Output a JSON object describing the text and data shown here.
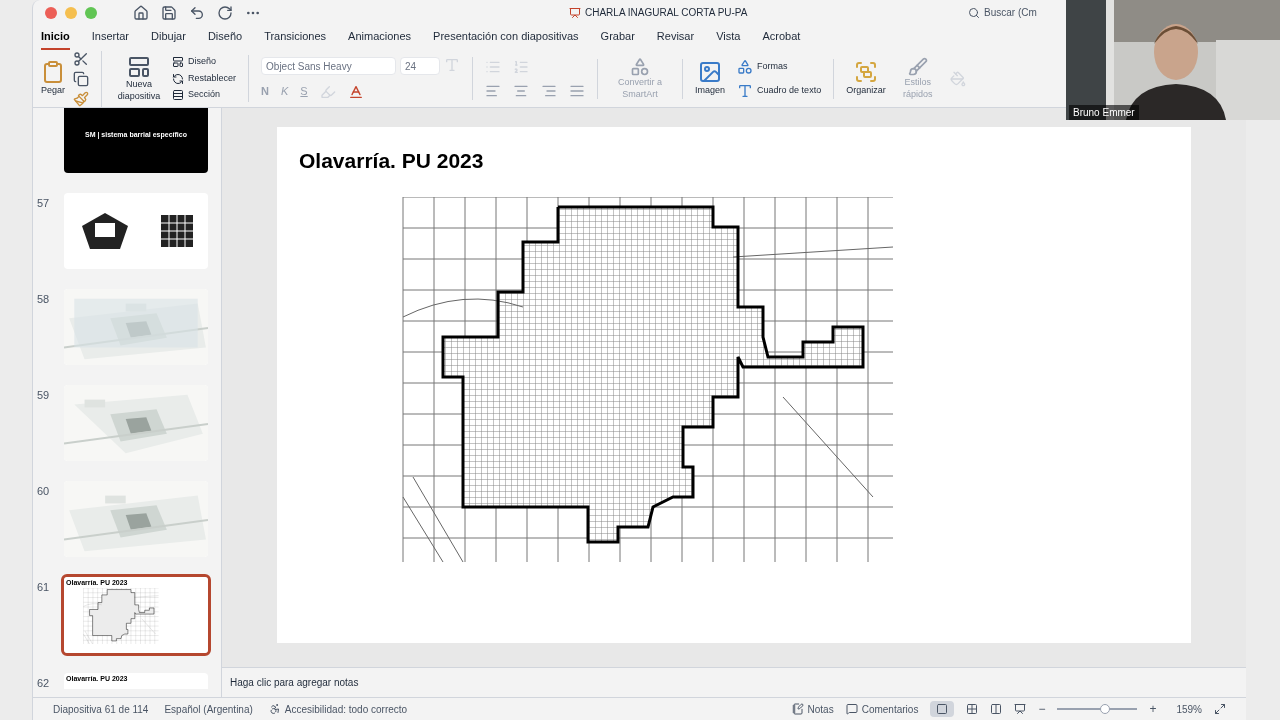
{
  "window": {
    "title": "CHARLA INAGURAL CORTA PU-PA",
    "search_placeholder": "Buscar (Cm"
  },
  "menu_tabs": [
    {
      "label": "Inicio",
      "selected": true
    },
    {
      "label": "Insertar",
      "selected": false
    },
    {
      "label": "Dibujar",
      "selected": false
    },
    {
      "label": "Diseño",
      "selected": false
    },
    {
      "label": "Transiciones",
      "selected": false
    },
    {
      "label": "Animaciones",
      "selected": false
    },
    {
      "label": "Presentación con diapositivas",
      "selected": false
    },
    {
      "label": "Grabar",
      "selected": false
    },
    {
      "label": "Revisar",
      "selected": false
    },
    {
      "label": "Vista",
      "selected": false
    },
    {
      "label": "Acrobat",
      "selected": false
    }
  ],
  "ribbon": {
    "paste": "Pegar",
    "new_slide": "Nueva diapositiva",
    "layout": "Diseño",
    "reset": "Restablecer",
    "section": "Sección",
    "font_name": "Object Sans Heavy",
    "font_size": "24",
    "format_letters": [
      "N",
      "K",
      "S"
    ],
    "smartart": "Convertir a SmartArt",
    "image": "Imagen",
    "shapes": "Formas",
    "textbox": "Cuadro de texto",
    "arrange": "Organizar",
    "quick_styles": "Estilos rápidos"
  },
  "thumbnails": [
    {
      "kind": "title",
      "text": "SM | sistema barrial específico",
      "selected": false
    },
    {
      "number": "57",
      "kind": "blocks",
      "selected": false
    },
    {
      "number": "58",
      "kind": "picture",
      "selected": false
    },
    {
      "number": "59",
      "kind": "picture",
      "selected": false
    },
    {
      "number": "60",
      "kind": "picture",
      "selected": false
    },
    {
      "number": "61",
      "kind": "map",
      "text": "Olavarría. PU 2023",
      "selected": true
    },
    {
      "number": "62",
      "kind": "partial",
      "text": "Olavarría. PU 2023",
      "selected": false
    }
  ],
  "slide": {
    "title": "Olavarría. PU 2023"
  },
  "notes": {
    "placeholder": "Haga clic para agregar notas"
  },
  "status_bar": {
    "slide_info": "Diapositiva 61 de 114",
    "language": "Español (Argentina)",
    "accessibility": "Accesibilidad: todo correcto",
    "notes": "Notas",
    "comments": "Comentarios",
    "zoom": "159%",
    "zoom_out": "−",
    "zoom_in": "+",
    "level": 0.6
  },
  "video": {
    "name": "Bruno Emmer"
  }
}
